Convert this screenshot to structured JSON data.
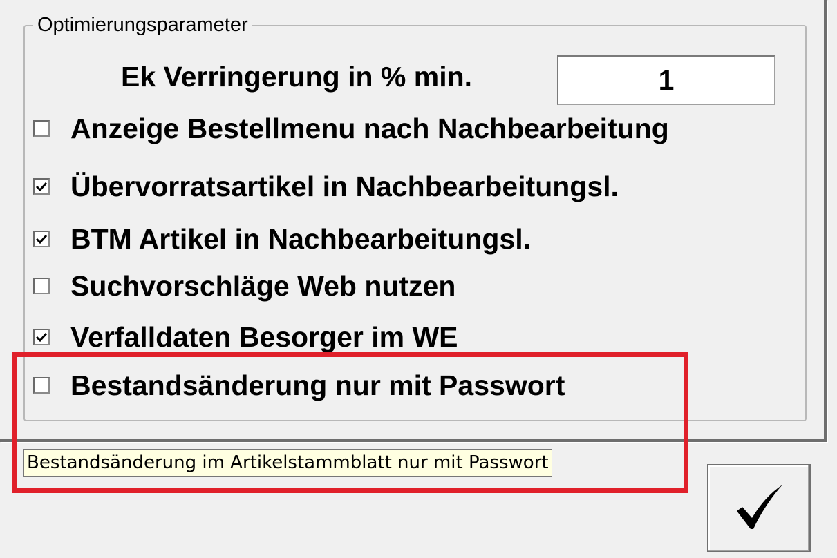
{
  "group": {
    "title": "Optimierungsparameter"
  },
  "ek_reduction": {
    "label": "Ek Verringerung in % min.",
    "value": "1"
  },
  "options": [
    {
      "label": "Anzeige Bestellmenu nach Nachbearbeitung",
      "checked": false
    },
    {
      "label": "Übervorratsartikel in Nachbearbeitungsl.",
      "checked": true
    },
    {
      "label": "BTM Artikel in Nachbearbeitungsl.",
      "checked": true
    },
    {
      "label": "Suchvorschläge Web nutzen",
      "checked": false
    },
    {
      "label": "Verfalldaten Besorger im WE",
      "checked": true
    },
    {
      "label": "Bestandsänderung nur mit Passwort",
      "checked": false
    }
  ],
  "tooltip": {
    "text": "Bestandsänderung im Artikelstammblatt nur mit Passwort"
  },
  "ok_button": {
    "icon": "checkmark-icon"
  },
  "colors": {
    "background": "#f0f0f0",
    "highlight": "#e0202a",
    "tooltip_bg": "#ffffe1"
  }
}
